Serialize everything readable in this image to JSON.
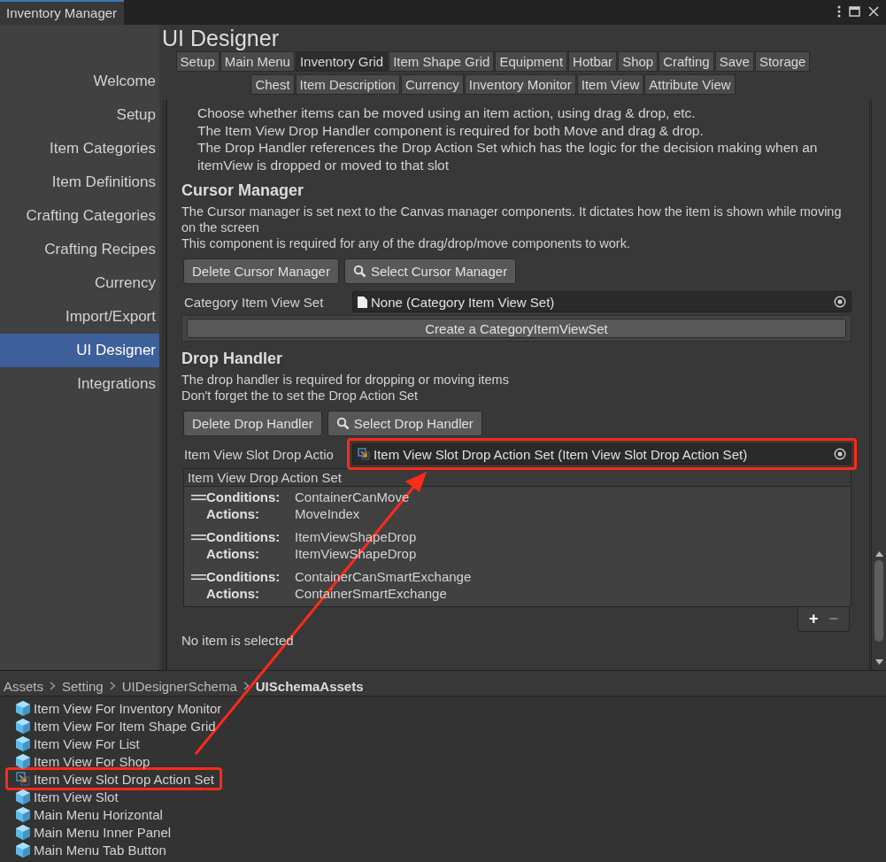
{
  "window": {
    "title": "Inventory Manager"
  },
  "sidebar": {
    "items": [
      {
        "label": "Welcome",
        "selected": false
      },
      {
        "label": "Setup",
        "selected": false
      },
      {
        "label": "Item Categories",
        "selected": false
      },
      {
        "label": "Item Definitions",
        "selected": false
      },
      {
        "label": "Crafting Categories",
        "selected": false
      },
      {
        "label": "Crafting Recipes",
        "selected": false
      },
      {
        "label": "Currency",
        "selected": false
      },
      {
        "label": "Import/Export",
        "selected": false
      },
      {
        "label": "UI Designer",
        "selected": true
      },
      {
        "label": "Integrations",
        "selected": false
      }
    ]
  },
  "page_title": "UI Designer",
  "tab_rows": [
    [
      {
        "label": "Setup",
        "selected": false
      },
      {
        "label": "Main Menu",
        "selected": false
      },
      {
        "label": "Inventory Grid",
        "selected": true
      },
      {
        "label": "Item Shape Grid",
        "selected": false
      },
      {
        "label": "Equipment",
        "selected": false
      },
      {
        "label": "Hotbar",
        "selected": false
      },
      {
        "label": "Shop",
        "selected": false
      },
      {
        "label": "Crafting",
        "selected": false
      },
      {
        "label": "Save",
        "selected": false
      },
      {
        "label": "Storage",
        "selected": false
      }
    ],
    [
      {
        "label": "Chest",
        "selected": false
      },
      {
        "label": "Item Description",
        "selected": false
      },
      {
        "label": "Currency",
        "selected": false
      },
      {
        "label": "Inventory Monitor",
        "selected": false
      },
      {
        "label": "Item View",
        "selected": false
      },
      {
        "label": "Attribute View",
        "selected": false
      }
    ]
  ],
  "intro": [
    "Choose whether items can be moved using an item action, using drag & drop, etc.",
    "The Item View Drop Handler component is required for both Move and drag & drop.",
    "The Drop Handler references the Drop Action Set which has the logic for the decision making when an itemView is dropped or moved to that slot"
  ],
  "cursor_manager": {
    "heading": "Cursor Manager",
    "description": [
      "The Cursor manager is set next to the Canvas manager components. It dictates how the item is shown while moving on the screen",
      "This component is required for any of the drag/drop/move components to work."
    ],
    "delete_button": "Delete Cursor Manager",
    "select_button": "Select Cursor Manager",
    "field_label": "Category Item View Set",
    "field_value": "None (Category Item View Set)",
    "field_highlighted": false,
    "create_button": "Create a CategoryItemViewSet"
  },
  "drop_handler": {
    "heading": "Drop Handler",
    "description": [
      "The drop handler is required for dropping or moving items",
      "Don't forget the to set the Drop Action Set"
    ],
    "delete_button": "Delete Drop Handler",
    "select_button": "Select Drop Handler",
    "field_label": "Item View Slot Drop Actio",
    "field_value": "Item View Slot Drop Action Set (Item View Slot Drop Action Set)",
    "field_highlighted": true
  },
  "action_list": {
    "header": "Item View Drop Action Set",
    "rows": [
      {
        "conditions_label": "Conditions:",
        "conditions": "ContainerCanMove",
        "actions_label": "Actions:",
        "actions": "MoveIndex"
      },
      {
        "conditions_label": "Conditions:",
        "conditions": "ItemViewShapeDrop",
        "actions_label": "Actions:",
        "actions": "ItemViewShapeDrop"
      },
      {
        "conditions_label": "Conditions:",
        "conditions": "ContainerCanSmartExchange",
        "actions_label": "Actions:",
        "actions": "ContainerSmartExchange"
      }
    ],
    "add_button": "+",
    "remove_button": "−",
    "remove_disabled": true,
    "status": "No item is selected"
  },
  "breadcrumb": [
    {
      "label": "Assets",
      "current": false
    },
    {
      "label": "Setting",
      "current": false
    },
    {
      "label": "UIDesignerSchema",
      "current": false
    },
    {
      "label": "UISchemaAssets",
      "current": true
    }
  ],
  "assets": [
    {
      "label": "Item View For Inventory Monitor",
      "kind": "prefab",
      "highlighted": false
    },
    {
      "label": "Item View For Item Shape Grid",
      "kind": "prefab",
      "highlighted": false
    },
    {
      "label": "Item View For List",
      "kind": "prefab",
      "highlighted": false
    },
    {
      "label": "Item View For Shop",
      "kind": "prefab",
      "highlighted": false
    },
    {
      "label": "Item View Slot Drop Action Set",
      "kind": "action-set",
      "highlighted": true
    },
    {
      "label": "Item View Slot",
      "kind": "prefab",
      "highlighted": false
    },
    {
      "label": "Main Menu Horizontal",
      "kind": "prefab",
      "highlighted": false
    },
    {
      "label": "Main Menu Inner Panel",
      "kind": "prefab",
      "highlighted": false
    },
    {
      "label": "Main Menu Tab Button",
      "kind": "prefab",
      "highlighted": false
    }
  ]
}
